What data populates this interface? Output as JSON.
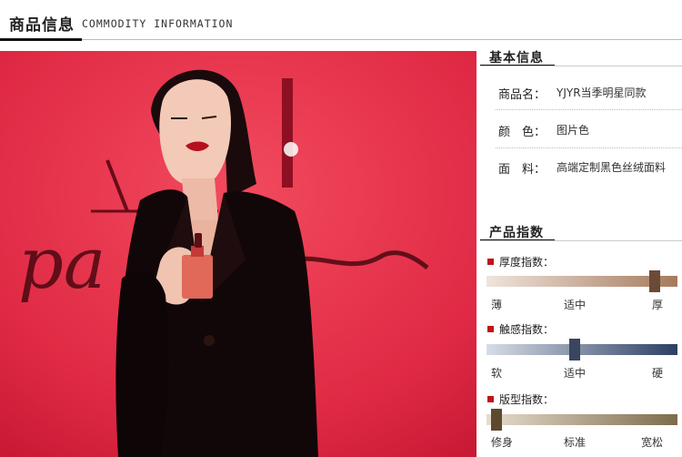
{
  "header": {
    "title": "商品信息",
    "subtitle": "COMMODITY INFORMATION"
  },
  "photo": {
    "sign_text": "pa   ne"
  },
  "basic_info": {
    "title": "基本信息",
    "rows": [
      {
        "label": "商品名：",
        "value": "YJYR当季明星同款"
      },
      {
        "label": "颜　色：",
        "value": "图片色"
      },
      {
        "label": "面　料：",
        "value": "高端定制黑色丝绒面料"
      }
    ]
  },
  "product_index": {
    "title": "产品指数",
    "indices": [
      {
        "label": "厚度指数：",
        "scale": [
          "薄",
          "适中",
          "厚"
        ],
        "level": 0.88,
        "color_from": "#efe4dc",
        "color_to": "#a57a5c",
        "thumb": "#6b4a38"
      },
      {
        "label": "触感指数：",
        "scale": [
          "软",
          "适中",
          "硬"
        ],
        "level": 0.46,
        "color_from": "#d7dde7",
        "color_to": "#2c3f63",
        "thumb": "#3a4560"
      },
      {
        "label": "版型指数：",
        "scale": [
          "修身",
          "标准",
          "宽松"
        ],
        "level": 0.05,
        "color_from": "#e6ddcd",
        "color_to": "#7e6b4d",
        "thumb": "#5d4a2e"
      }
    ]
  }
}
